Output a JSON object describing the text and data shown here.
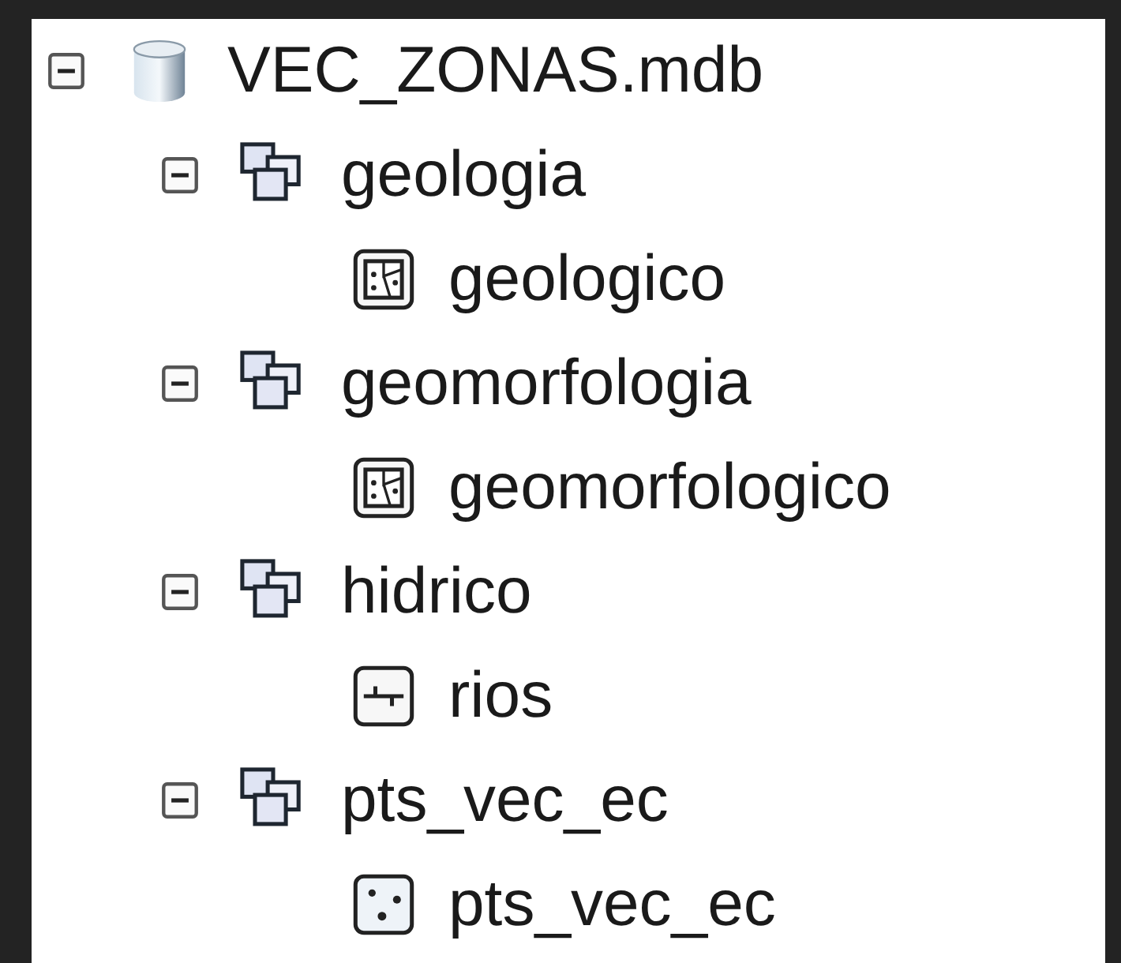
{
  "tree": [
    {
      "kind": "database",
      "label": "VEC_ZONAS.mdb",
      "expanded": true,
      "children": [
        {
          "kind": "dataset",
          "label": "geologia",
          "expanded": true,
          "children": [
            {
              "kind": "polygon",
              "label": "geologico"
            }
          ]
        },
        {
          "kind": "dataset",
          "label": "geomorfologia",
          "expanded": true,
          "children": [
            {
              "kind": "polygon",
              "label": "geomorfologico"
            }
          ]
        },
        {
          "kind": "dataset",
          "label": "hidrico",
          "expanded": true,
          "children": [
            {
              "kind": "line",
              "label": "rios"
            }
          ]
        },
        {
          "kind": "dataset",
          "label": "pts_vec_ec",
          "expanded": true,
          "children": [
            {
              "kind": "point",
              "label": "pts_vec_ec"
            }
          ]
        }
      ]
    }
  ]
}
